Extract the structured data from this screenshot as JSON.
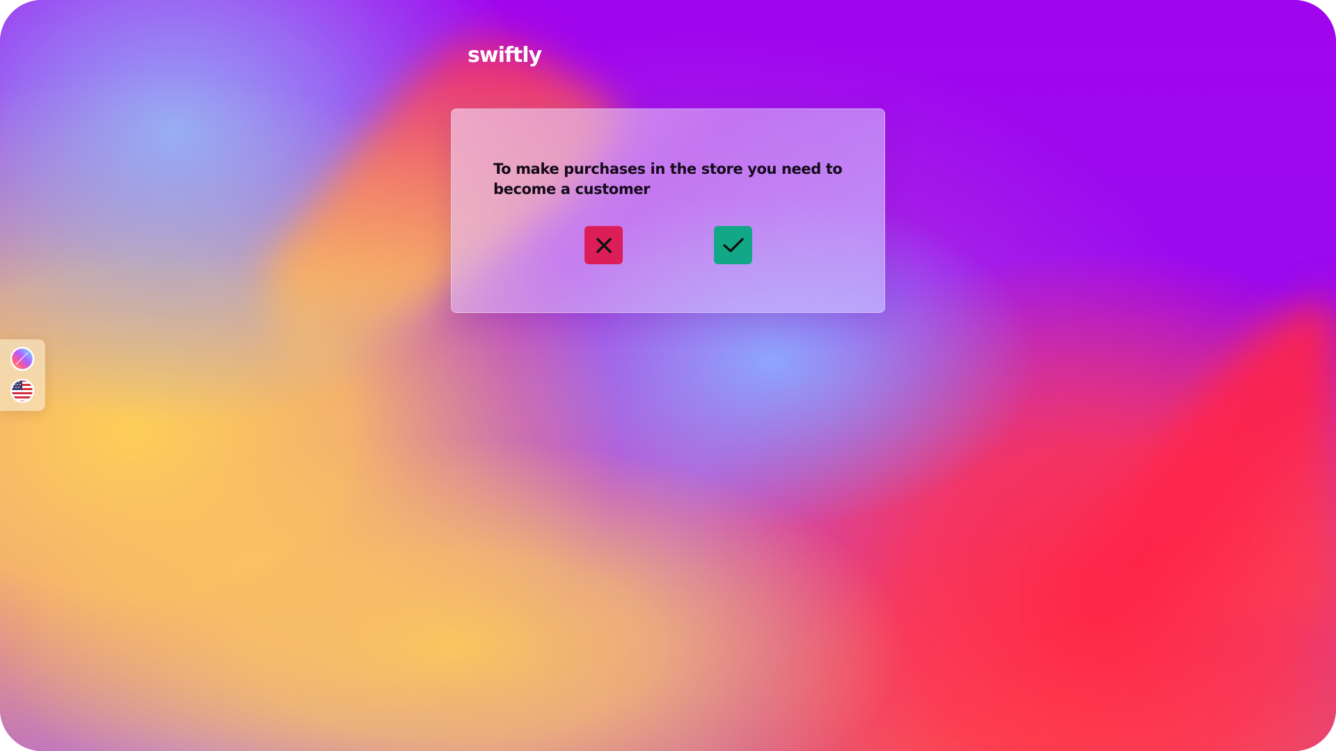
{
  "app": {
    "logo_text": "swiftly"
  },
  "dialog": {
    "message": "To make purchases in the store you need to become a customer",
    "cancel_icon": "close-icon",
    "confirm_icon": "check-icon"
  },
  "side_panel": {
    "items": [
      {
        "icon": "theme-palette-icon"
      },
      {
        "icon": "us-flag-icon"
      }
    ]
  },
  "colors": {
    "cancel": "#dc1e58",
    "confirm": "#12a887",
    "icon_stroke": "#111111",
    "logo": "#ffffff"
  }
}
